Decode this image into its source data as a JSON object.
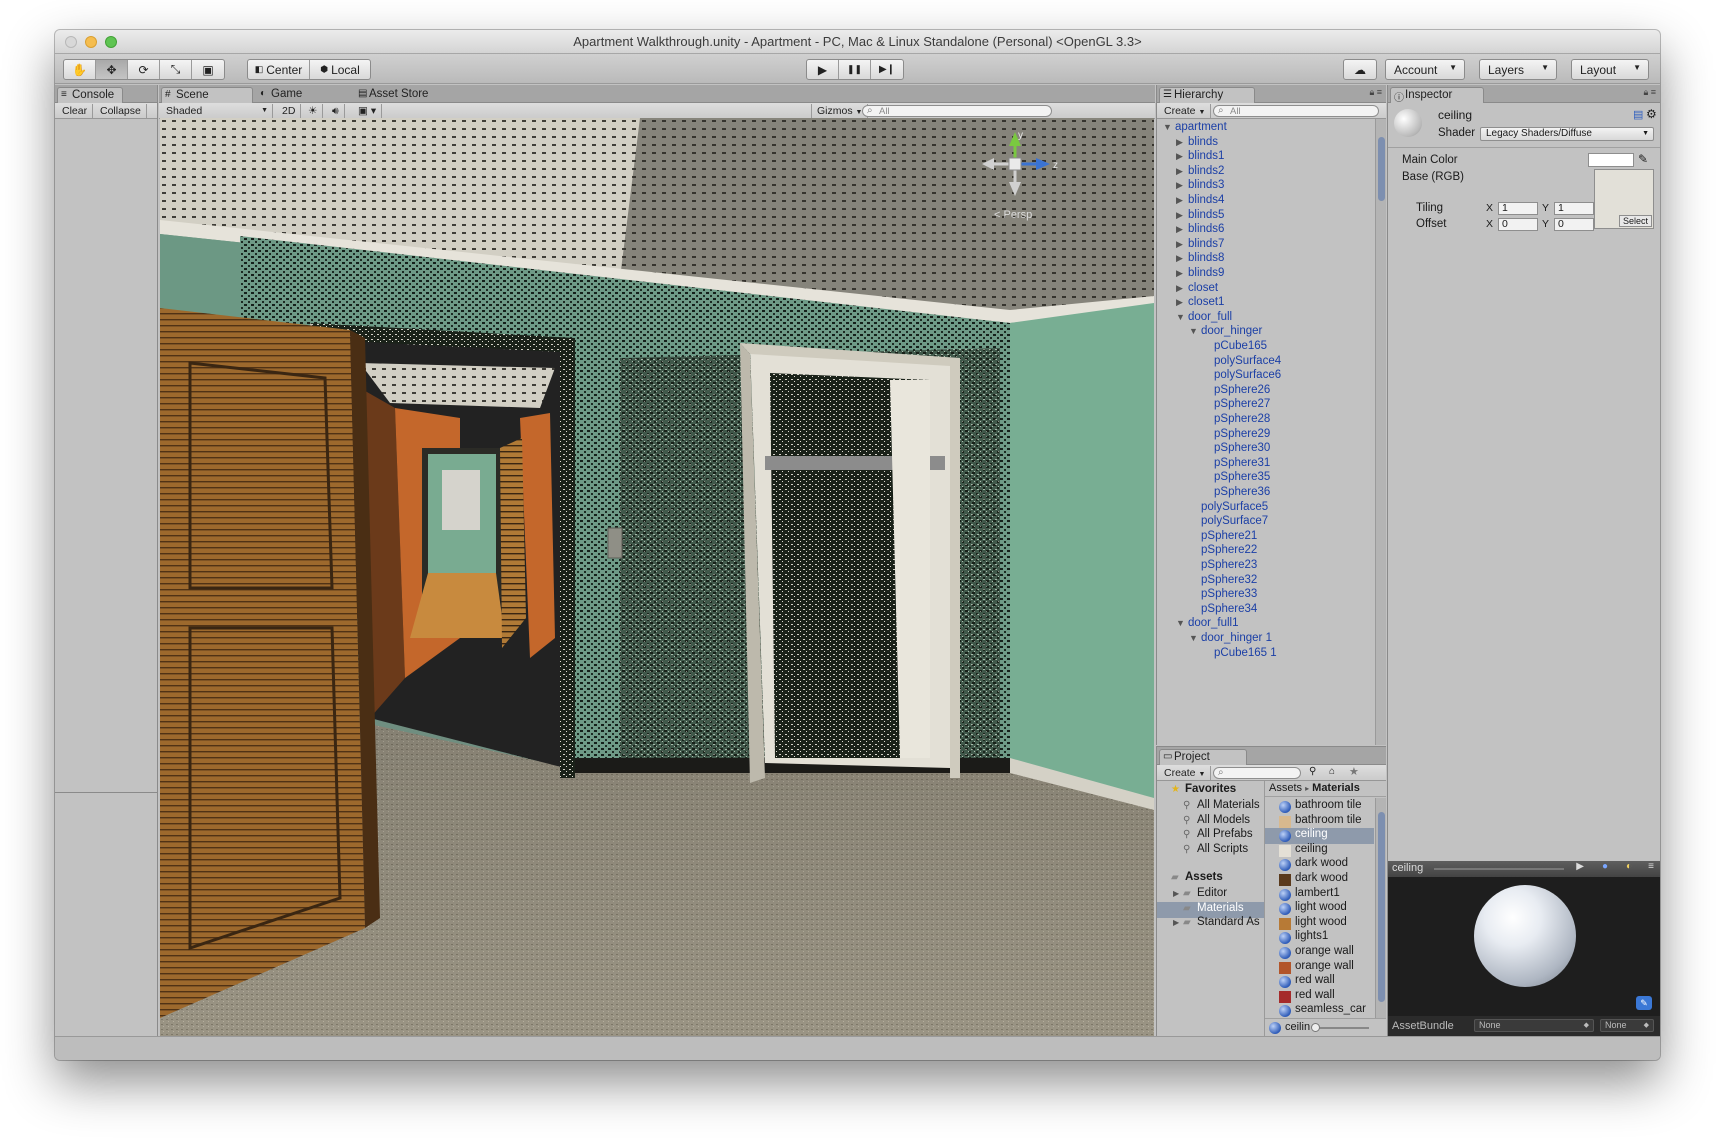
{
  "window": {
    "title": "Apartment Walkthrough.unity - Apartment - PC, Mac & Linux Standalone (Personal) <OpenGL 3.3>"
  },
  "toolbar": {
    "tools": [
      "hand-tool",
      "move-tool",
      "rotate-tool",
      "scale-tool",
      "rect-tool"
    ],
    "tool_glyphs": [
      "✋",
      "✥",
      "⟳",
      "⤡",
      "▣"
    ],
    "pivot": "Center",
    "space": "Local",
    "play_glyph": "▶",
    "pause_glyph": "❚❚",
    "step_glyph": "▶❙",
    "account": "Account",
    "layers": "Layers",
    "layout": "Layout"
  },
  "console": {
    "tab": "Console",
    "clear": "Clear",
    "collapse": "Collapse"
  },
  "scene": {
    "tabs": [
      "Scene",
      "Game",
      "Asset Store"
    ],
    "shading": "Shaded",
    "mode2d": "2D",
    "gizmos": "Gizmos",
    "search_placeholder": "All",
    "persp": "< Persp",
    "axis_y": "y",
    "axis_z": "z"
  },
  "hierarchy": {
    "tab": "Hierarchy",
    "create": "Create",
    "search_placeholder": "All",
    "items": [
      {
        "label": "apartment",
        "depth": 0,
        "arrow": "▼"
      },
      {
        "label": "blinds",
        "depth": 1,
        "arrow": "▶"
      },
      {
        "label": "blinds1",
        "depth": 1,
        "arrow": "▶"
      },
      {
        "label": "blinds2",
        "depth": 1,
        "arrow": "▶"
      },
      {
        "label": "blinds3",
        "depth": 1,
        "arrow": "▶"
      },
      {
        "label": "blinds4",
        "depth": 1,
        "arrow": "▶"
      },
      {
        "label": "blinds5",
        "depth": 1,
        "arrow": "▶"
      },
      {
        "label": "blinds6",
        "depth": 1,
        "arrow": "▶"
      },
      {
        "label": "blinds7",
        "depth": 1,
        "arrow": "▶"
      },
      {
        "label": "blinds8",
        "depth": 1,
        "arrow": "▶"
      },
      {
        "label": "blinds9",
        "depth": 1,
        "arrow": "▶"
      },
      {
        "label": "closet",
        "depth": 1,
        "arrow": "▶"
      },
      {
        "label": "closet1",
        "depth": 1,
        "arrow": "▶"
      },
      {
        "label": "door_full",
        "depth": 1,
        "arrow": "▼"
      },
      {
        "label": "door_hinger",
        "depth": 2,
        "arrow": "▼"
      },
      {
        "label": "pCube165",
        "depth": 3,
        "arrow": ""
      },
      {
        "label": "polySurface4",
        "depth": 3,
        "arrow": ""
      },
      {
        "label": "polySurface6",
        "depth": 3,
        "arrow": ""
      },
      {
        "label": "pSphere26",
        "depth": 3,
        "arrow": ""
      },
      {
        "label": "pSphere27",
        "depth": 3,
        "arrow": ""
      },
      {
        "label": "pSphere28",
        "depth": 3,
        "arrow": ""
      },
      {
        "label": "pSphere29",
        "depth": 3,
        "arrow": ""
      },
      {
        "label": "pSphere30",
        "depth": 3,
        "arrow": ""
      },
      {
        "label": "pSphere31",
        "depth": 3,
        "arrow": ""
      },
      {
        "label": "pSphere35",
        "depth": 3,
        "arrow": ""
      },
      {
        "label": "pSphere36",
        "depth": 3,
        "arrow": ""
      },
      {
        "label": "polySurface5",
        "depth": 2,
        "arrow": ""
      },
      {
        "label": "polySurface7",
        "depth": 2,
        "arrow": ""
      },
      {
        "label": "pSphere21",
        "depth": 2,
        "arrow": ""
      },
      {
        "label": "pSphere22",
        "depth": 2,
        "arrow": ""
      },
      {
        "label": "pSphere23",
        "depth": 2,
        "arrow": ""
      },
      {
        "label": "pSphere32",
        "depth": 2,
        "arrow": ""
      },
      {
        "label": "pSphere33",
        "depth": 2,
        "arrow": ""
      },
      {
        "label": "pSphere34",
        "depth": 2,
        "arrow": ""
      },
      {
        "label": "door_full1",
        "depth": 1,
        "arrow": "▼"
      },
      {
        "label": "door_hinger 1",
        "depth": 2,
        "arrow": "▼"
      },
      {
        "label": "pCube165 1",
        "depth": 3,
        "arrow": ""
      }
    ]
  },
  "project": {
    "tab": "Project",
    "create": "Create",
    "favorites_label": "Favorites",
    "favorites": [
      "All Materials",
      "All Models",
      "All Prefabs",
      "All Scripts"
    ],
    "assets_label": "Assets",
    "folders": [
      {
        "label": "Editor",
        "arrow": "▶",
        "selected": false
      },
      {
        "label": "Materials",
        "arrow": "",
        "selected": true
      },
      {
        "label": "Standard As",
        "arrow": "▶",
        "selected": false
      }
    ],
    "breadcrumb_root": "Assets",
    "breadcrumb_sep": "▸",
    "breadcrumb_leaf": "Materials",
    "assets": [
      {
        "label": "bathroom tile",
        "kind": "sphere",
        "color": "#3b6cc9",
        "selected": false
      },
      {
        "label": "bathroom tile",
        "kind": "swatch",
        "color": "#d8b98e",
        "selected": false
      },
      {
        "label": "ceiling",
        "kind": "sphere",
        "color": "#3b6cc9",
        "selected": true
      },
      {
        "label": "ceiling",
        "kind": "swatch",
        "color": "#e4e0d6",
        "selected": false
      },
      {
        "label": "dark wood",
        "kind": "sphere",
        "color": "#3b6cc9",
        "selected": false
      },
      {
        "label": "dark wood",
        "kind": "swatch",
        "color": "#5a3a1d",
        "selected": false
      },
      {
        "label": "lambert1",
        "kind": "sphere",
        "color": "#3b6cc9",
        "selected": false
      },
      {
        "label": "light wood",
        "kind": "sphere",
        "color": "#3b6cc9",
        "selected": false
      },
      {
        "label": "light wood",
        "kind": "swatch",
        "color": "#b77a36",
        "selected": false
      },
      {
        "label": "lights1",
        "kind": "sphere",
        "color": "#3b6cc9",
        "selected": false
      },
      {
        "label": "orange wall",
        "kind": "sphere",
        "color": "#3b6cc9",
        "selected": false
      },
      {
        "label": "orange wall",
        "kind": "swatch",
        "color": "#b2552a",
        "selected": false
      },
      {
        "label": "red wall",
        "kind": "sphere",
        "color": "#3b6cc9",
        "selected": false
      },
      {
        "label": "red wall",
        "kind": "swatch",
        "color": "#a52b2b",
        "selected": false
      },
      {
        "label": "seamless_car",
        "kind": "sphere",
        "color": "#3b6cc9",
        "selected": false
      }
    ],
    "bottom_label": "ceilin"
  },
  "inspector": {
    "tab": "Inspector",
    "object_name": "ceiling",
    "shader_label": "Shader",
    "shader_value": "Legacy Shaders/Diffuse",
    "main_color_label": "Main Color",
    "base_label": "Base (RGB)",
    "tiling_label": "Tiling",
    "offset_label": "Offset",
    "x_label": "X",
    "y_label": "Y",
    "tiling_x": "1",
    "tiling_y": "1",
    "offset_x": "0",
    "offset_y": "0",
    "select_button": "Select",
    "preview_title": "ceiling",
    "assetbundle_label": "AssetBundle",
    "assetbundle_value": "None",
    "assetbundle_variant": "None"
  }
}
